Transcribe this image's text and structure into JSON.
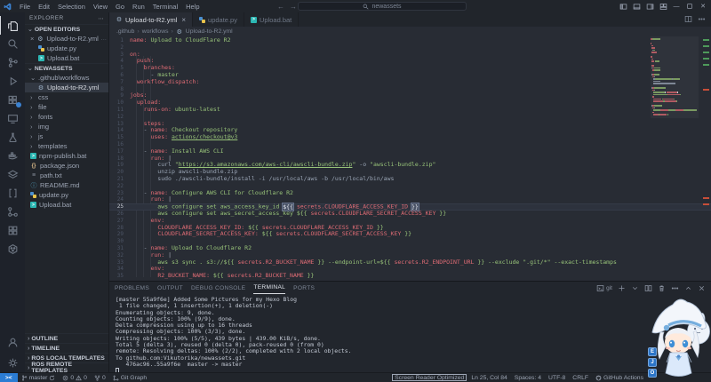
{
  "colors": {
    "chrome_bg": "#21252b",
    "editor_bg": "#282c34",
    "accent_red": "#e06c75",
    "accent_green": "#98c379",
    "remote_blue": "#2b7cd3",
    "badge_blue": "#2e7cd6",
    "active_text": "#d7dae0"
  },
  "titlebar": {
    "menus": [
      "File",
      "Edit",
      "Selection",
      "View",
      "Go",
      "Run",
      "Terminal",
      "Help"
    ],
    "search_value": "newassets",
    "window_controls": [
      "layout-sidebar-left",
      "layout-panel",
      "layout-sidebar-right",
      "layout-custom",
      "minimize",
      "maximize",
      "close"
    ]
  },
  "activitybar": {
    "top": [
      {
        "icon": "explorer",
        "active": true
      },
      {
        "icon": "search"
      },
      {
        "icon": "source-control"
      },
      {
        "icon": "run-debug"
      },
      {
        "icon": "extensions",
        "badge": true
      },
      {
        "icon": "remote-explorer"
      },
      {
        "icon": "test-beaker"
      },
      {
        "icon": "docker"
      },
      {
        "icon": "layers"
      },
      {
        "icon": "brackets"
      },
      {
        "icon": "git-graph"
      },
      {
        "icon": "boxes"
      },
      {
        "icon": "ros-hexagon"
      }
    ],
    "bottom": [
      {
        "icon": "account"
      },
      {
        "icon": "settings-gear"
      }
    ]
  },
  "explorer": {
    "title": "EXPLORER",
    "more": "⋯",
    "open_editors_label": "OPEN EDITORS",
    "open_editors": [
      {
        "close": "×",
        "icon": "yaml",
        "label": "Upload-to-R2.yml",
        "desc": ".github\\workfl...",
        "active": true
      },
      {
        "icon": "python",
        "label": "update.py"
      },
      {
        "icon": "bat",
        "label": "Upload.bat"
      }
    ],
    "workspace": "NEWASSETS",
    "tree": [
      {
        "chev": "⌄",
        "label": ".github\\workflows",
        "kind": "folder"
      },
      {
        "icon": "yaml",
        "label": "Upload-to-R2.yml",
        "indent": 1,
        "selected": true
      },
      {
        "chev": "›",
        "label": "css",
        "kind": "folder"
      },
      {
        "chev": "›",
        "label": "file",
        "kind": "folder"
      },
      {
        "chev": "›",
        "label": "fonts",
        "kind": "folder"
      },
      {
        "chev": "›",
        "label": "img",
        "kind": "folder"
      },
      {
        "chev": "›",
        "label": "js",
        "kind": "folder"
      },
      {
        "chev": "›",
        "label": "templates",
        "kind": "folder"
      },
      {
        "icon": "bat",
        "label": "npm-publish.bat"
      },
      {
        "icon": "json",
        "label": "package.json"
      },
      {
        "icon": "txt",
        "label": "path.txt"
      },
      {
        "icon": "info",
        "label": "README.md"
      },
      {
        "icon": "python",
        "label": "update.py"
      },
      {
        "icon": "bat",
        "label": "Upload.bat"
      }
    ],
    "bottom_sections": [
      "OUTLINE",
      "TIMELINE",
      "ROS LOCAL TEMPLATES",
      "ROS REMOTE TEMPLATES"
    ]
  },
  "tabs": [
    {
      "label": "Upload-to-R2.yml",
      "icon": "yaml",
      "active": true,
      "close": "×"
    },
    {
      "label": "update.py",
      "icon": "python"
    },
    {
      "label": "Upload.bat",
      "icon": "bat"
    }
  ],
  "tab_actions": [
    "split-editor",
    "more-actions"
  ],
  "breadcrumb": [
    ".github",
    "workflows",
    "Upload-to-R2.yml"
  ],
  "editor": {
    "lines": [
      {
        "n": 1,
        "tokens": [
          [
            "k",
            "name:"
          ],
          [
            "t",
            " "
          ],
          [
            "s",
            "Upload to CloudFlare R2"
          ]
        ]
      },
      {
        "n": 2,
        "tokens": []
      },
      {
        "n": 3,
        "tokens": [
          [
            "k",
            "on:"
          ]
        ]
      },
      {
        "n": 4,
        "tokens": [
          [
            "t",
            "  "
          ],
          [
            "k",
            "push:"
          ]
        ]
      },
      {
        "n": 5,
        "tokens": [
          [
            "t",
            "    "
          ],
          [
            "k",
            "branches:"
          ]
        ]
      },
      {
        "n": 6,
        "tokens": [
          [
            "t",
            "      - "
          ],
          [
            "s",
            "master"
          ]
        ]
      },
      {
        "n": 7,
        "tokens": [
          [
            "t",
            "  "
          ],
          [
            "k",
            "workflow_dispatch:"
          ]
        ]
      },
      {
        "n": 8,
        "tokens": []
      },
      {
        "n": 9,
        "tokens": [
          [
            "k",
            "jobs:"
          ]
        ]
      },
      {
        "n": 10,
        "tokens": [
          [
            "t",
            "  "
          ],
          [
            "k",
            "upload:"
          ]
        ]
      },
      {
        "n": 11,
        "tokens": [
          [
            "t",
            "    "
          ],
          [
            "k",
            "runs-on:"
          ],
          [
            "t",
            " "
          ],
          [
            "s",
            "ubuntu-latest"
          ]
        ]
      },
      {
        "n": 12,
        "tokens": []
      },
      {
        "n": 13,
        "tokens": [
          [
            "t",
            "    "
          ],
          [
            "k",
            "steps:"
          ]
        ]
      },
      {
        "n": 14,
        "tokens": [
          [
            "t",
            "    - "
          ],
          [
            "k",
            "name:"
          ],
          [
            "t",
            " "
          ],
          [
            "s",
            "Checkout repository"
          ]
        ]
      },
      {
        "n": 15,
        "tokens": [
          [
            "t",
            "      "
          ],
          [
            "k",
            "uses:"
          ],
          [
            "t",
            " "
          ],
          [
            "su",
            "actions/checkout@v3"
          ]
        ]
      },
      {
        "n": 16,
        "tokens": []
      },
      {
        "n": 17,
        "tokens": [
          [
            "t",
            "    - "
          ],
          [
            "k",
            "name:"
          ],
          [
            "t",
            " "
          ],
          [
            "s",
            "Install AWS CLI"
          ]
        ]
      },
      {
        "n": 18,
        "tokens": [
          [
            "t",
            "      "
          ],
          [
            "k",
            "run:"
          ],
          [
            "t",
            " "
          ],
          [
            "o",
            "|"
          ]
        ]
      },
      {
        "n": 19,
        "tokens": [
          [
            "t",
            "        curl "
          ],
          [
            "s",
            "\""
          ],
          [
            "su",
            "https://s3.amazonaws.com/aws-cli/awscli-bundle.zip"
          ],
          [
            "s",
            "\""
          ],
          [
            "t",
            " -o "
          ],
          [
            "s",
            "\"awscli-bundle.zip\""
          ]
        ]
      },
      {
        "n": 20,
        "tokens": [
          [
            "t",
            "        unzip awscli-bundle.zip"
          ]
        ]
      },
      {
        "n": 21,
        "tokens": [
          [
            "t",
            "        sudo ./awscli-bundle/install -i /usr/local/aws -b /usr/local/bin/aws"
          ]
        ]
      },
      {
        "n": 22,
        "tokens": []
      },
      {
        "n": 23,
        "tokens": [
          [
            "t",
            "    - "
          ],
          [
            "k",
            "name:"
          ],
          [
            "t",
            " "
          ],
          [
            "s",
            "Configure AWS CLI for Cloudflare R2"
          ]
        ]
      },
      {
        "n": 24,
        "tokens": [
          [
            "t",
            "      "
          ],
          [
            "k",
            "run:"
          ],
          [
            "t",
            " "
          ],
          [
            "o",
            "|"
          ]
        ]
      },
      {
        "n": 25,
        "cur": true,
        "caret": true,
        "tokens": [
          [
            "s",
            "        aws configure set aws_access_key_id "
          ],
          [
            "hl",
            "${{"
          ],
          [
            "s",
            " "
          ],
          [
            "x",
            "secrets.CLOUDFLARE_ACCESS_KEY_ID"
          ],
          [
            "s",
            " "
          ],
          [
            "hl",
            "}}"
          ]
        ]
      },
      {
        "n": 26,
        "tokens": [
          [
            "s",
            "        aws configure set aws_secret_access_key ${{ "
          ],
          [
            "x",
            "secrets.CLOUDFLARE_SECRET_ACCESS_KEY"
          ],
          [
            "s",
            " }}"
          ]
        ]
      },
      {
        "n": 27,
        "tokens": [
          [
            "t",
            "      "
          ],
          [
            "k",
            "env:"
          ]
        ]
      },
      {
        "n": 28,
        "tokens": [
          [
            "t",
            "        "
          ],
          [
            "k",
            "CLOUDFLARE_ACCESS_KEY_ID:"
          ],
          [
            "s",
            " ${{ "
          ],
          [
            "x",
            "secrets.CLOUDFLARE_ACCESS_KEY_ID"
          ],
          [
            "s",
            " }}"
          ]
        ]
      },
      {
        "n": 29,
        "tokens": [
          [
            "t",
            "        "
          ],
          [
            "k",
            "CLOUDFLARE_SECRET_ACCESS_KEY:"
          ],
          [
            "s",
            " ${{ "
          ],
          [
            "x",
            "secrets.CLOUDFLARE_SECRET_ACCESS_KEY"
          ],
          [
            "s",
            " }}"
          ]
        ]
      },
      {
        "n": 30,
        "tokens": []
      },
      {
        "n": 31,
        "tokens": [
          [
            "t",
            "    - "
          ],
          [
            "k",
            "name:"
          ],
          [
            "t",
            " "
          ],
          [
            "s",
            "Upload to Cloudflare R2"
          ]
        ]
      },
      {
        "n": 32,
        "tokens": [
          [
            "t",
            "      "
          ],
          [
            "k",
            "run:"
          ],
          [
            "t",
            " "
          ],
          [
            "o",
            "|"
          ]
        ]
      },
      {
        "n": 33,
        "tokens": [
          [
            "s",
            "        aws s3 sync . s3://${{ "
          ],
          [
            "x",
            "secrets.R2_BUCKET_NAME"
          ],
          [
            "s",
            " }} --endpoint-url=${{ "
          ],
          [
            "x",
            "secrets.R2_ENDPOINT_URL"
          ],
          [
            "s",
            " }} --exclude \".git/*\" --exact-timestamps"
          ]
        ]
      },
      {
        "n": 34,
        "tokens": [
          [
            "t",
            "      "
          ],
          [
            "k",
            "env:"
          ]
        ]
      },
      {
        "n": 35,
        "tokens": [
          [
            "t",
            "        "
          ],
          [
            "k",
            "R2_BUCKET_NAME:"
          ],
          [
            "s",
            " ${{ "
          ],
          [
            "x",
            "secrets.R2_BUCKET_NAME"
          ],
          [
            "s",
            " }}"
          ]
        ]
      }
    ]
  },
  "panel": {
    "tabs": [
      "PROBLEMS",
      "OUTPUT",
      "DEBUG CONSOLE",
      "TERMINAL",
      "PORTS"
    ],
    "active_tab": "TERMINAL",
    "terminal_name": "git",
    "actions": [
      "new-terminal",
      "profiles-dropdown",
      "split-terminal",
      "kill-terminal",
      "more-actions",
      "maximize-panel",
      "close-panel"
    ],
    "terminal_lines": [
      "[master 55a9f6e] Added Some Pictures for my Hexo Blog",
      " 1 file changed, 1 insertion(+), 1 deletion(-)",
      "Enumerating objects: 9, done.",
      "Counting objects: 100% (9/9), done.",
      "Delta compression using up to 16 threads",
      "Compressing objects: 100% (3/3), done.",
      "Writing objects: 100% (5/5), 439 bytes | 439.00 KiB/s, done.",
      "Total 5 (delta 3), reused 0 (delta 0), pack-reused 0 (from 0)",
      "remote: Resolving deltas: 100% (2/2), completed with 2 local objects.",
      "To github.com:Vikutorika/newassets.git",
      "   476ac96..55a9f6e  master -> master"
    ],
    "cursor": true
  },
  "statusbar": {
    "left": [
      {
        "name": "remote-indicator",
        "style": "remote",
        "parts": [
          {
            "tx": "><"
          }
        ]
      },
      {
        "name": "branch-indicator",
        "parts": [
          {
            "ic": "branch"
          },
          {
            "tx": "master"
          },
          {
            "ic": "sync"
          }
        ]
      },
      {
        "name": "problems-indicator",
        "parts": [
          {
            "ic": "error"
          },
          {
            "tx": "0"
          },
          {
            "ic": "warning"
          },
          {
            "tx": "0"
          }
        ]
      },
      {
        "name": "fork-indicator",
        "parts": [
          {
            "ic": "fork"
          },
          {
            "tx": "0"
          }
        ]
      },
      {
        "name": "git-graph-button",
        "parts": [
          {
            "ic": "graph"
          },
          {
            "tx": "Git Graph"
          }
        ]
      }
    ],
    "right": [
      {
        "name": "screen-reader-mode",
        "boxed": true,
        "parts": [
          {
            "tx": "Screen Reader Optimized"
          }
        ]
      },
      {
        "name": "cursor-position",
        "parts": [
          {
            "tx": "Ln 25, Col 84"
          }
        ]
      },
      {
        "name": "indentation",
        "parts": [
          {
            "tx": "Spaces: 4"
          }
        ]
      },
      {
        "name": "encoding",
        "parts": [
          {
            "tx": "UTF-8"
          }
        ]
      },
      {
        "name": "eol",
        "parts": [
          {
            "tx": "CRLF"
          }
        ]
      },
      {
        "name": "language-mode",
        "parts": [
          {
            "ic": "github"
          },
          {
            "tx": "GitHub Actions"
          }
        ]
      }
    ]
  },
  "overlay": {
    "badges": [
      "E",
      "J",
      "O"
    ]
  }
}
